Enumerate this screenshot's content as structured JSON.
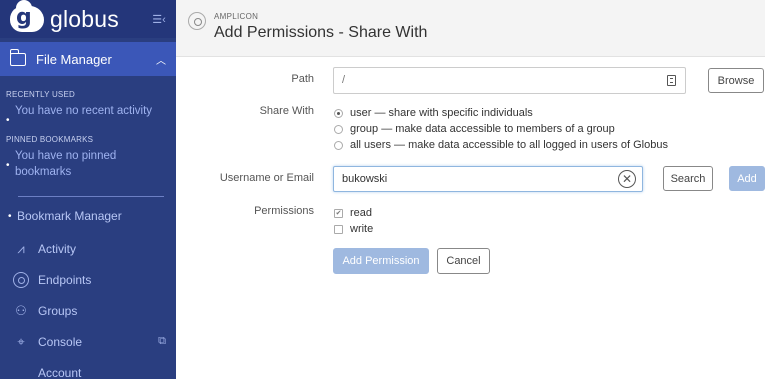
{
  "sidebar": {
    "logo_text": "globus",
    "file_manager_label": "File Manager",
    "recently_used_heading": "RECENTLY USED",
    "recent_empty": "You have no recent activity",
    "pinned_heading": "PINNED BOOKMARKS",
    "pinned_empty": "You have no pinned bookmarks",
    "bookmark_manager": "Bookmark Manager",
    "nav": [
      {
        "label": "Activity",
        "icon": "activity-pulse-icon"
      },
      {
        "label": "Endpoints",
        "icon": "endpoint-icon"
      },
      {
        "label": "Groups",
        "icon": "groups-icon"
      },
      {
        "label": "Console",
        "icon": "console-icon"
      },
      {
        "label": "Account",
        "icon": "account-icon"
      }
    ]
  },
  "header": {
    "endpoint_name": "AMPLICON",
    "title": "Add Permissions - Share With"
  },
  "form": {
    "path_label": "Path",
    "path_value": "/",
    "browse_label": "Browse",
    "share_with_label": "Share With",
    "share_options": [
      {
        "label": "user — share with specific individuals",
        "checked": true
      },
      {
        "label": "group — make data accessible to members of a group",
        "checked": false
      },
      {
        "label": "all users — make data accessible to all logged in users of Globus",
        "checked": false
      }
    ],
    "username_label": "Username or Email",
    "username_value": "bukowski",
    "search_label": "Search",
    "add_label": "Add",
    "permissions_label": "Permissions",
    "permissions": [
      {
        "label": "read",
        "checked": true
      },
      {
        "label": "write",
        "checked": false
      }
    ],
    "add_permission_label": "Add Permission",
    "cancel_label": "Cancel"
  },
  "colors": {
    "sidebar_bg": "#2a3e80",
    "sidebar_active": "#3b57b8",
    "primary_button": "#9fb9e0"
  }
}
